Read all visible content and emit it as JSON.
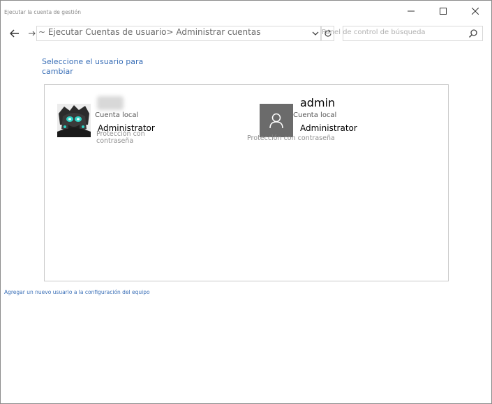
{
  "window": {
    "title": "Ejecutar la cuenta de gestión"
  },
  "address_bar": {
    "path": "~ Ejecutar Cuentas de usuario> Administrar cuentas"
  },
  "search": {
    "placeholder": "Panel de control de búsqueda"
  },
  "page": {
    "heading": "Seleccione el usuario para cambiar"
  },
  "accounts": [
    {
      "avatar": "anime-character-avatar",
      "name": "",
      "type": "Cuenta local",
      "role": "Administrator",
      "protection": "Protección con contraseña"
    },
    {
      "avatar": "default-user-icon",
      "name": "admin",
      "type": "Cuenta local",
      "role": "Administrator",
      "protection": "Protección con contraseña"
    }
  ],
  "add_user_link": "Agregar un nuevo usuario a la configuración del equipo",
  "colors": {
    "link": "#3a6fb7",
    "default_avatar_bg": "#6b6b6b",
    "panel_border": "#c8c8c8"
  }
}
